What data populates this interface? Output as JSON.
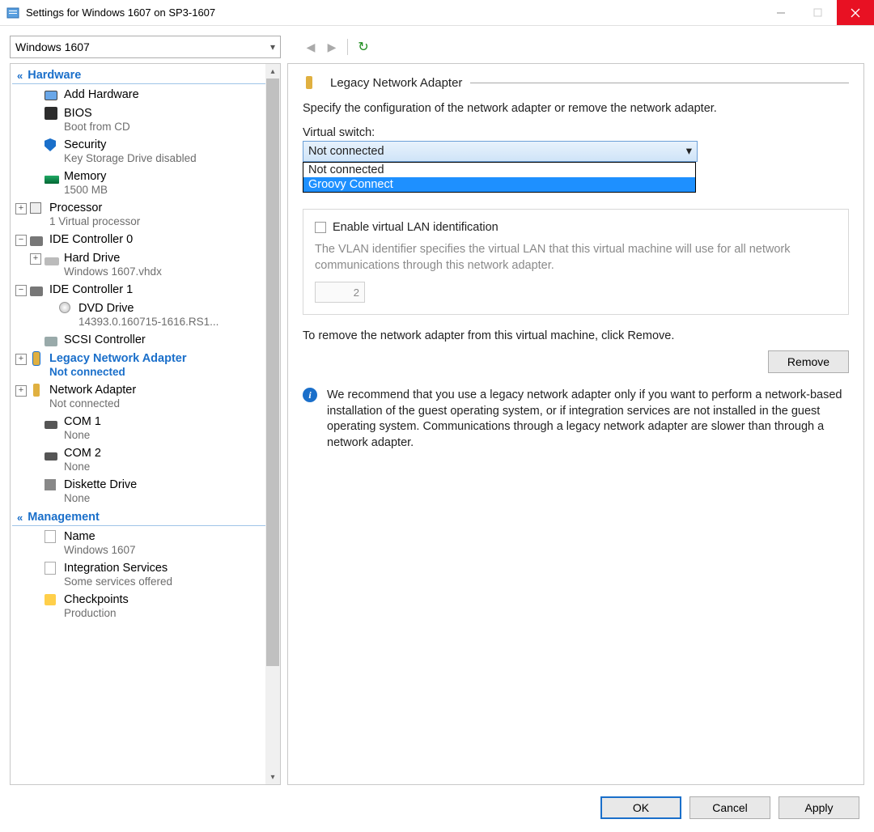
{
  "titlebar": {
    "text": "Settings for Windows 1607 on SP3-1607"
  },
  "vm_selector": {
    "value": "Windows 1607"
  },
  "sections": {
    "hardware": "Hardware",
    "management": "Management"
  },
  "tree": {
    "add_hardware": "Add Hardware",
    "bios": {
      "label": "BIOS",
      "sub": "Boot from CD"
    },
    "security": {
      "label": "Security",
      "sub": "Key Storage Drive disabled"
    },
    "memory": {
      "label": "Memory",
      "sub": "1500 MB"
    },
    "processor": {
      "label": "Processor",
      "sub": "1 Virtual processor"
    },
    "ide0": {
      "label": "IDE Controller 0"
    },
    "hard_drive": {
      "label": "Hard Drive",
      "sub": "Windows 1607.vhdx"
    },
    "ide1": {
      "label": "IDE Controller 1"
    },
    "dvd": {
      "label": "DVD Drive",
      "sub": "14393.0.160715-1616.RS1..."
    },
    "scsi": {
      "label": "SCSI Controller"
    },
    "legacy_net": {
      "label": "Legacy Network Adapter",
      "sub": "Not connected"
    },
    "net": {
      "label": "Network Adapter",
      "sub": "Not connected"
    },
    "com1": {
      "label": "COM 1",
      "sub": "None"
    },
    "com2": {
      "label": "COM 2",
      "sub": "None"
    },
    "diskette": {
      "label": "Diskette Drive",
      "sub": "None"
    },
    "name": {
      "label": "Name",
      "sub": "Windows 1607"
    },
    "integration": {
      "label": "Integration Services",
      "sub": "Some services offered"
    },
    "checkpoints": {
      "label": "Checkpoints",
      "sub": "Production"
    }
  },
  "detail": {
    "title": "Legacy Network Adapter",
    "desc": "Specify the configuration of the network adapter or remove the network adapter.",
    "vswitch_label": "Virtual switch:",
    "vswitch_value": "Not connected",
    "vswitch_options": [
      "Not connected",
      "Groovy Connect"
    ],
    "vlan_check": "Enable virtual LAN identification",
    "vlan_desc": "The VLAN identifier specifies the virtual LAN that this virtual machine will use for all network communications through this network adapter.",
    "vlan_id": "2",
    "remove_text": "To remove the network adapter from this virtual machine, click Remove.",
    "remove_btn": "Remove",
    "info": "We recommend that you use a legacy network adapter only if you want to perform a network-based installation of the guest operating system, or if integration services are not installed in the guest operating system. Communications through a legacy network adapter are slower than through a network adapter."
  },
  "buttons": {
    "ok": "OK",
    "cancel": "Cancel",
    "apply": "Apply"
  }
}
